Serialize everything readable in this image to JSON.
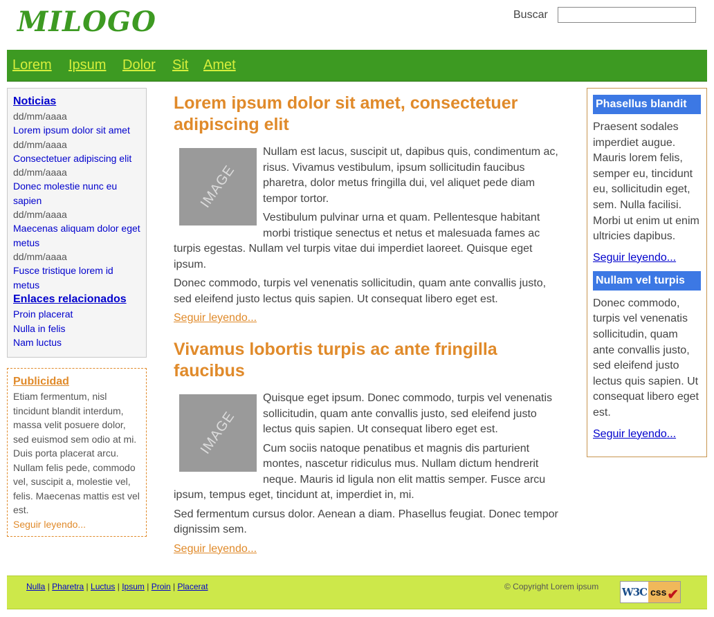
{
  "header": {
    "logo": "MILOGO",
    "search_label": "Buscar",
    "search_value": ""
  },
  "nav": {
    "items": [
      "Lorem",
      "Ipsum",
      "Dolor",
      "Sit",
      "Amet"
    ]
  },
  "left_sidebar": {
    "news_title": "Noticias",
    "news": [
      {
        "date": "dd/mm/aaaa",
        "title": "Lorem ipsum dolor sit amet"
      },
      {
        "date": "dd/mm/aaaa",
        "title": "Consectetuer adipiscing elit"
      },
      {
        "date": "dd/mm/aaaa",
        "title": "Donec molestie nunc eu sapien"
      },
      {
        "date": "dd/mm/aaaa",
        "title": "Maecenas aliquam dolor eget metus"
      },
      {
        "date": "dd/mm/aaaa",
        "title": "Fusce tristique lorem id metus"
      }
    ],
    "links_title": "Enlaces relacionados",
    "links": [
      "Proin placerat",
      "Nulla in felis",
      "Nam luctus"
    ],
    "ad": {
      "title": "Publicidad",
      "text": "Etiam fermentum, nisl tincidunt blandit interdum, massa velit posuere dolor, sed euismod sem odio at mi. Duis porta placerat arcu. Nullam felis pede, commodo vel, suscipit a, molestie vel, felis. Maecenas mattis est vel est.",
      "more": "Seguir leyendo..."
    }
  },
  "main": {
    "articles": [
      {
        "title": "Lorem ipsum dolor sit amet, consectetuer adipiscing elit",
        "image_label": "IMAGE",
        "paragraphs": [
          "Nullam est lacus, suscipit ut, dapibus quis, condimentum ac, risus. Vivamus vestibulum, ipsum sollicitudin faucibus pharetra, dolor metus fringilla dui, vel aliquet pede diam tempor tortor.",
          "Vestibulum pulvinar urna et quam. Pellentesque habitant morbi tristique senectus et netus et malesuada fames ac turpis egestas. Nullam vel turpis vitae dui imperdiet laoreet. Quisque eget ipsum.",
          "Donec commodo, turpis vel venenatis sollicitudin, quam ante convallis justo, sed eleifend justo lectus quis sapien. Ut consequat libero eget est."
        ],
        "more": "Seguir leyendo..."
      },
      {
        "title": "Vivamus lobortis turpis ac ante fringilla faucibus",
        "image_label": "IMAGE",
        "paragraphs": [
          "Quisque eget ipsum. Donec commodo, turpis vel venenatis sollicitudin, quam ante convallis justo, sed eleifend justo lectus quis sapien. Ut consequat libero eget est.",
          "Cum sociis natoque penatibus et magnis dis parturient montes, nascetur ridiculus mus. Nullam dictum hendrerit neque. Mauris id ligula non elit mattis semper. Fusce arcu ipsum, tempus eget, tincidunt at, imperdiet in, mi.",
          "Sed fermentum cursus dolor. Aenean a diam. Phasellus feugiat. Donec tempor dignissim sem."
        ],
        "more": "Seguir leyendo..."
      }
    ]
  },
  "right_sidebar": {
    "blocks": [
      {
        "title": "Phasellus blandit",
        "text": "Praesent sodales imperdiet augue. Mauris lorem felis, semper eu, tincidunt eu, sollicitudin eget, sem. Nulla facilisi. Morbi ut enim ut enim ultricies dapibus.",
        "more": "Seguir leyendo..."
      },
      {
        "title": "Nullam vel turpis",
        "text": "Donec commodo, turpis vel venenatis sollicitudin, quam ante convallis justo, sed eleifend justo lectus quis sapien. Ut consequat libero eget est.",
        "more": "Seguir leyendo..."
      }
    ]
  },
  "footer": {
    "links": [
      "Nulla",
      "Pharetra",
      "Luctus",
      "Ipsum",
      "Proin",
      "Placerat"
    ],
    "separator": "|",
    "copyright": "© Copyright Lorem ipsum",
    "badge": {
      "w3c": "W3C",
      "css": "css",
      "check": "✔"
    }
  },
  "colors": {
    "brand_green": "#3d9a22",
    "nav_link": "#d6ef3c",
    "accent_orange": "#e08a2a",
    "block_blue": "#3c78e4",
    "footer_lime": "#cde84a"
  }
}
